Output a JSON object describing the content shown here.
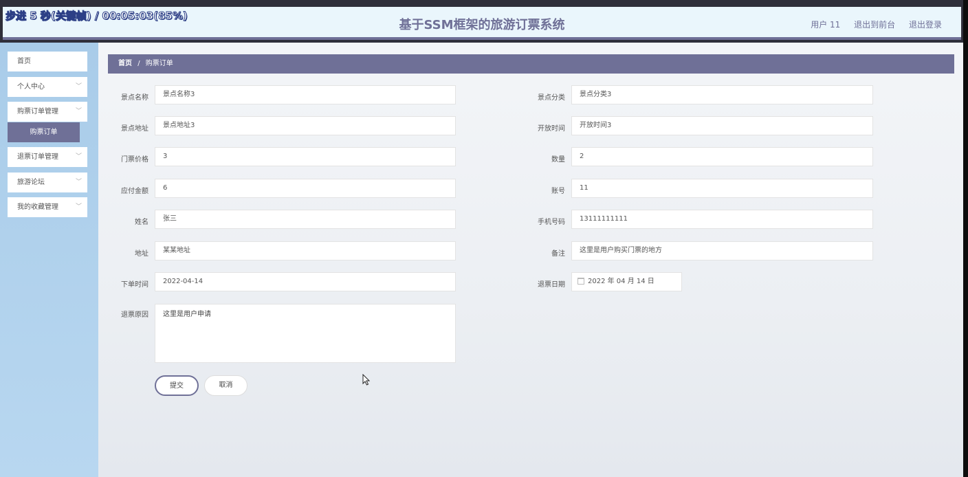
{
  "overlay": "步进 5 秒(关键帧) / 00:05:03(85%)",
  "header": {
    "title": "基于SSM框架的旅游订票系统",
    "user": "用户 11",
    "back_front": "退出到前台",
    "logout": "退出登录"
  },
  "sidebar": {
    "items": [
      {
        "label": "首页"
      },
      {
        "label": "个人中心"
      },
      {
        "label": "购票订单管理"
      },
      {
        "label": "退票订单管理"
      },
      {
        "label": "旅游论坛"
      },
      {
        "label": "我的收藏管理"
      }
    ],
    "submenu_active": "购票订单"
  },
  "breadcrumb": {
    "home": "首页",
    "sep": "/",
    "current": "购票订单"
  },
  "form": {
    "left": [
      {
        "label": "景点名称",
        "value": "景点名称3"
      },
      {
        "label": "景点地址",
        "value": "景点地址3"
      },
      {
        "label": "门票价格",
        "value": "3"
      },
      {
        "label": "应付金额",
        "value": "6"
      },
      {
        "label": "姓名",
        "value": "张三"
      },
      {
        "label": "地址",
        "value": "某某地址"
      },
      {
        "label": "下单时间",
        "value": "2022-04-14"
      }
    ],
    "right": [
      {
        "label": "景点分类",
        "value": "景点分类3"
      },
      {
        "label": "开放时间",
        "value": "开放时间3"
      },
      {
        "label": "数量",
        "value": "2"
      },
      {
        "label": "账号",
        "value": "11"
      },
      {
        "label": "手机号码",
        "value": "13111111111"
      },
      {
        "label": "备注",
        "value": "这里是用户购买门票的地方"
      },
      {
        "label": "退票日期",
        "value": "2022 年 04 月 14 日"
      }
    ],
    "reason_label": "退票原因",
    "reason_value": "这里是用户申请",
    "submit": "提交",
    "cancel": "取消"
  }
}
